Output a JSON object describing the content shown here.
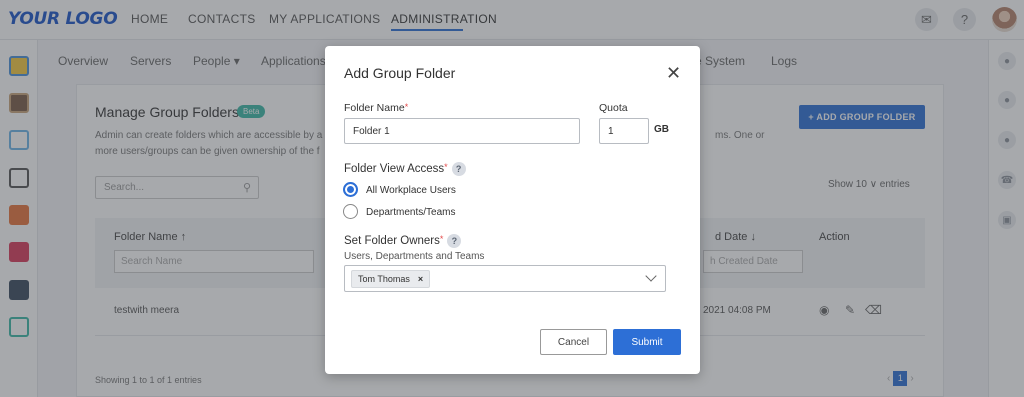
{
  "logo": "YOUR LOGO",
  "top_nav": [
    "HOME",
    "CONTACTS",
    "MY APPLICATIONS",
    "ADMINISTRATION"
  ],
  "top_icons": [
    "notification-icon",
    "help-icon",
    "avatar"
  ],
  "left_apps": [
    "app-1-icon",
    "app-2-icon",
    "app-3-icon",
    "app-4-icon",
    "app-5-icon",
    "app-6-icon",
    "app-7-icon",
    "app-8-icon"
  ],
  "right_icons": [
    "chat-icon",
    "user-icon",
    "users-icon",
    "phone-icon",
    "calendar-icon"
  ],
  "sub_nav": [
    "Overview",
    "Servers",
    "People",
    "Applications",
    "e System",
    "Logs"
  ],
  "page": {
    "title": "Manage Group Folders",
    "beta": "Beta",
    "description": "Admin can create folders which are accessible by a",
    "description_line2": "more users/groups can be given ownership of the f",
    "description_right": "ms. One or",
    "add_button": "+ ADD GROUP FOLDER",
    "search_placeholder": "Search...",
    "show_entries": "Show  10   ∨  entries"
  },
  "table": {
    "headers": [
      "Folder Name ↑",
      "d Date ↓",
      "Action"
    ],
    "filter_placeholders": [
      "Search Name",
      "h Created Date"
    ],
    "rows": [
      {
        "name": "testwith meera",
        "date": "2021 04:08 PM"
      }
    ],
    "showing": "Showing 1 to 1 of 1 entries",
    "page": "1"
  },
  "modal": {
    "title": "Add Group Folder",
    "folder_name_label": "Folder Name",
    "folder_name_value": "Folder 1",
    "quota_label": "Quota",
    "quota_value": "1",
    "quota_unit": "GB",
    "view_access_label": "Folder View Access",
    "options": [
      "All Workplace Users",
      "Departments/Teams"
    ],
    "selected_option": "All Workplace Users",
    "owners_label": "Set Folder Owners",
    "owners_sublabel": "Users, Departments and Teams",
    "owner_tags": [
      "Tom Thomas"
    ],
    "cancel": "Cancel",
    "submit": "Submit",
    "help_glyph": "?",
    "required_mark": "*",
    "close_glyph": "✕"
  },
  "colors": {
    "primary": "#2d6fd6",
    "logo": "#1a54c9",
    "beta_badge": "#3bb8a6",
    "required": "#e54b4b"
  }
}
